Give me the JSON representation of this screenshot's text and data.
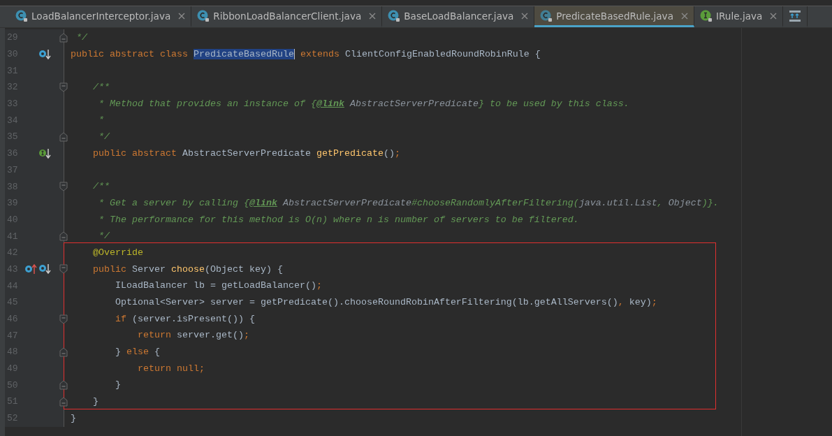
{
  "tabs": [
    {
      "label": "LoadBalancerInterceptor.java",
      "kind": "class",
      "selected": false
    },
    {
      "label": "RibbonLoadBalancerClient.java",
      "kind": "class",
      "selected": false
    },
    {
      "label": "BaseLoadBalancer.java",
      "kind": "class",
      "selected": false
    },
    {
      "label": "PredicateBasedRule.java",
      "kind": "abstract-class",
      "selected": true
    },
    {
      "label": "IRule.java",
      "kind": "interface",
      "selected": false
    },
    {
      "kind": "structure",
      "selected": false
    }
  ],
  "editor": {
    "sections": [
      {
        "boxed": false,
        "lines": [
          {
            "number": "29",
            "kind": "fold-end",
            "tokens": [
              {
                "t": " */",
                "kind": "comment"
              }
            ]
          },
          {
            "number": "30",
            "kind": "plain",
            "markers": [
              {
                "kind": "implemented"
              }
            ],
            "tokens": [
              {
                "t": "public abstract class ",
                "kind": "kw"
              },
              {
                "t": "PredicateBasedRule",
                "kind": "selected"
              },
              {
                "t": " extends ",
                "kind": "kw"
              },
              {
                "t": "ClientConfigEnabledRoundRobinRule {",
                "kind": "plain"
              }
            ]
          },
          {
            "number": "31",
            "kind": "plain"
          },
          {
            "number": "32",
            "kind": "fold-start",
            "tokens": [
              {
                "t": "    /**",
                "kind": "comment"
              }
            ]
          },
          {
            "number": "33",
            "kind": "plain",
            "tokens": [
              {
                "t": "     * Method that provides an instance of {",
                "kind": "comment"
              },
              {
                "t": "@link",
                "kind": "doctag"
              },
              {
                "t": " AbstractServerPredicate",
                "kind": "docref"
              },
              {
                "t": "} to be used by this class.",
                "kind": "comment"
              }
            ]
          },
          {
            "number": "34",
            "kind": "plain",
            "tokens": [
              {
                "t": "     *",
                "kind": "comment"
              }
            ]
          },
          {
            "number": "35",
            "kind": "fold-end",
            "tokens": [
              {
                "t": "     */",
                "kind": "comment"
              }
            ]
          },
          {
            "number": "36",
            "kind": "plain",
            "markers": [
              {
                "kind": "interface-implemented"
              }
            ],
            "tokens": [
              {
                "t": "    public abstract ",
                "kind": "kw"
              },
              {
                "t": "AbstractServerPredicate ",
                "kind": "plain"
              },
              {
                "t": "getPredicate",
                "kind": "method"
              },
              {
                "t": "()",
                "kind": "plain"
              },
              {
                "t": ";",
                "kind": "semi"
              }
            ]
          },
          {
            "number": "37",
            "kind": "plain"
          },
          {
            "number": "38",
            "kind": "fold-start",
            "tokens": [
              {
                "t": "    /**",
                "kind": "comment"
              }
            ]
          },
          {
            "number": "39",
            "kind": "plain",
            "tokens": [
              {
                "t": "     * Get a server by calling {",
                "kind": "comment"
              },
              {
                "t": "@link",
                "kind": "doctag"
              },
              {
                "t": " AbstractServerPredicate",
                "kind": "docref"
              },
              {
                "t": "#chooseRandomlyAfterFiltering(",
                "kind": "comment"
              },
              {
                "t": "java.util.List",
                "kind": "docref"
              },
              {
                "t": ", ",
                "kind": "comment"
              },
              {
                "t": "Object",
                "kind": "docref"
              },
              {
                "t": ")}.",
                "kind": "comment"
              }
            ]
          },
          {
            "number": "40",
            "kind": "plain",
            "tokens": [
              {
                "t": "     * The performance for this method is O(n) where n is number of servers to be filtered.",
                "kind": "comment"
              }
            ]
          },
          {
            "number": "41",
            "kind": "fold-end",
            "tokens": [
              {
                "t": "     */",
                "kind": "comment"
              }
            ]
          }
        ]
      },
      {
        "boxed": true,
        "lines": [
          {
            "number": "42",
            "kind": "plain",
            "tokens": [
              {
                "t": "    @Override",
                "kind": "annotation"
              }
            ]
          },
          {
            "number": "43",
            "kind": "fold-start",
            "markers": [
              {
                "kind": "overrides"
              },
              {
                "kind": "implemented"
              }
            ],
            "tokens": [
              {
                "t": "    public ",
                "kind": "kw"
              },
              {
                "t": "Server ",
                "kind": "plain"
              },
              {
                "t": "choose",
                "kind": "method"
              },
              {
                "t": "(Object key) {",
                "kind": "plain"
              }
            ]
          },
          {
            "number": "44",
            "kind": "plain",
            "tokens": [
              {
                "t": "        ILoadBalancer lb = getLoadBalancer()",
                "kind": "plain"
              },
              {
                "t": ";",
                "kind": "semi"
              }
            ]
          },
          {
            "number": "45",
            "kind": "plain",
            "tokens": [
              {
                "t": "        Optional<Server> server = getPredicate().chooseRoundRobinAfterFiltering(lb.getAllServers()",
                "kind": "plain"
              },
              {
                "t": ",",
                "kind": "semi"
              },
              {
                "t": " key)",
                "kind": "plain"
              },
              {
                "t": ";",
                "kind": "semi"
              }
            ]
          },
          {
            "number": "46",
            "kind": "fold-start",
            "tokens": [
              {
                "t": "        if ",
                "kind": "kw"
              },
              {
                "t": "(server.isPresent()) {",
                "kind": "plain"
              }
            ]
          },
          {
            "number": "47",
            "kind": "plain",
            "tokens": [
              {
                "t": "            return ",
                "kind": "kw"
              },
              {
                "t": "server.get()",
                "kind": "plain"
              },
              {
                "t": ";",
                "kind": "semi"
              }
            ]
          },
          {
            "number": "48",
            "kind": "fold-end",
            "tokens": [
              {
                "t": "        } ",
                "kind": "plain"
              },
              {
                "t": "else ",
                "kind": "kw"
              },
              {
                "t": "{",
                "kind": "plain"
              }
            ]
          },
          {
            "number": "49",
            "kind": "plain",
            "tokens": [
              {
                "t": "            return null",
                "kind": "kw"
              },
              {
                "t": ";",
                "kind": "semi"
              }
            ]
          },
          {
            "number": "50",
            "kind": "fold-end",
            "tokens": [
              {
                "t": "        }",
                "kind": "plain"
              }
            ]
          },
          {
            "number": "51",
            "kind": "fold-end",
            "tokens": [
              {
                "t": "    }",
                "kind": "plain"
              }
            ]
          }
        ]
      },
      {
        "boxed": false,
        "lines": [
          {
            "number": "52",
            "kind": "plain",
            "tokens": [
              {
                "t": "}",
                "kind": "plain"
              }
            ]
          }
        ]
      }
    ]
  }
}
